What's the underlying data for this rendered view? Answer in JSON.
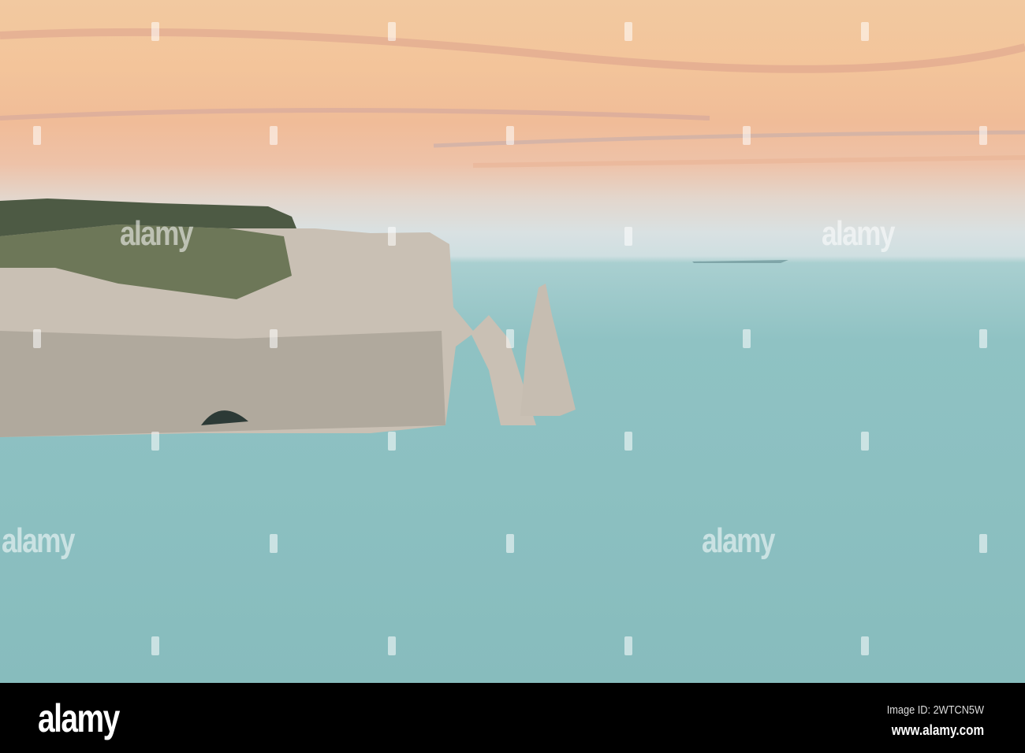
{
  "watermark": {
    "text": "alamy"
  },
  "footer": {
    "logo": "alamy",
    "image_id": "Image ID: 2WTCN5W",
    "url": "www.alamy.com"
  }
}
